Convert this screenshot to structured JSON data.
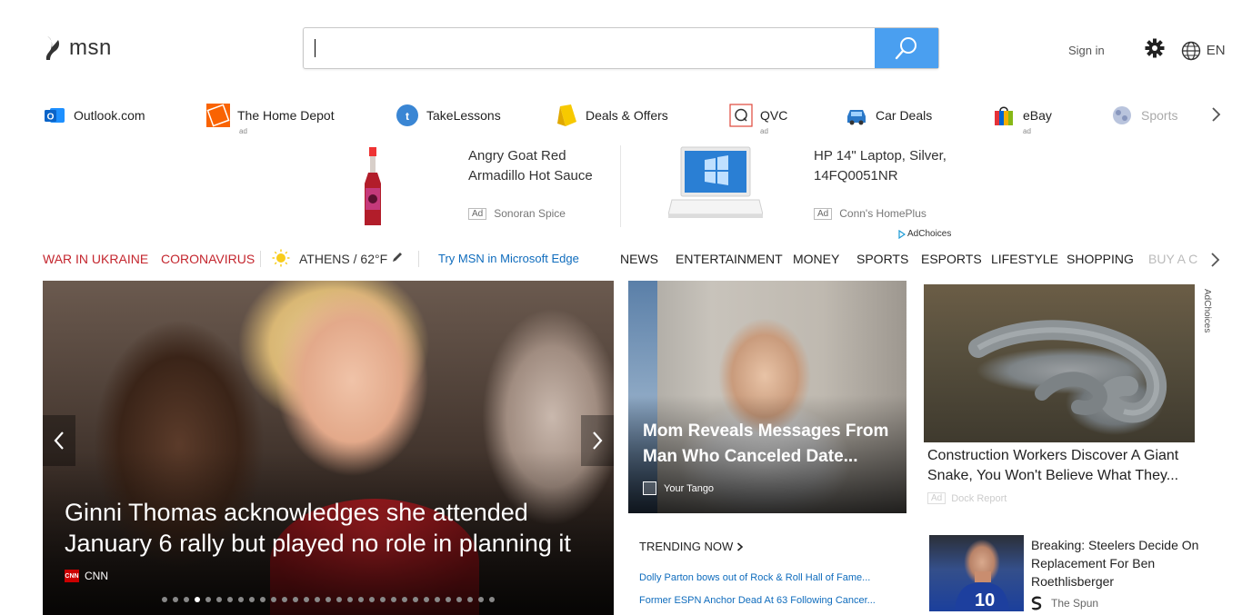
{
  "header": {
    "logo_text": "msn",
    "search_placeholder": "",
    "sign_in": "Sign in",
    "language": "EN"
  },
  "quicklinks": [
    {
      "label": "Outlook.com",
      "icon": "outlook-icon",
      "ad": ""
    },
    {
      "label": "The Home Depot",
      "icon": "home-depot-icon",
      "ad": "ad"
    },
    {
      "label": "TakeLessons",
      "icon": "takelessons-icon",
      "ad": ""
    },
    {
      "label": "Deals & Offers",
      "icon": "deals-icon",
      "ad": ""
    },
    {
      "label": "QVC",
      "icon": "qvc-icon",
      "ad": "ad"
    },
    {
      "label": "Car Deals",
      "icon": "car-icon",
      "ad": ""
    },
    {
      "label": "eBay",
      "icon": "ebay-icon",
      "ad": "ad"
    },
    {
      "label": "Sports",
      "icon": "sports-icon",
      "ad": ""
    }
  ],
  "ad_strip": {
    "items": [
      {
        "title": "Angry Goat Red Armadillo Hot Sauce",
        "badge": "Ad",
        "advertiser": "Sonoran Spice"
      },
      {
        "title": "HP 14\" Laptop, Silver, 14FQ0051NR",
        "badge": "Ad",
        "advertiser": "Conn's HomePlus"
      }
    ],
    "adchoices": "AdChoices"
  },
  "nav": {
    "war": "WAR IN UKRAINE",
    "corona": "CORONAVIRUS",
    "weather": "ATHENS / 62°F",
    "edge": "Try MSN in Microsoft Edge",
    "categories": [
      "NEWS",
      "ENTERTAINMENT",
      "MONEY",
      "SPORTS",
      "ESPORTS",
      "LIFESTYLE",
      "SHOPPING",
      "BUY A C"
    ]
  },
  "hero": {
    "title": "Ginni Thomas acknowledges she attended January 6 rally but played no role in planning it",
    "source": "CNN",
    "source_logo": "CNN",
    "dots_total": 31,
    "active_dot": 3
  },
  "mid_card": {
    "title": "Mom Reveals Messages From Man Who Canceled Date...",
    "source": "Your Tango"
  },
  "right_ad": {
    "title": "Construction Workers Discover A Giant Snake, You Won't Believe What They...",
    "badge": "Ad",
    "advertiser": "Dock Report",
    "adchoices": "AdChoices"
  },
  "trending": {
    "heading": "TRENDING NOW",
    "items": [
      "Dolly Parton bows out of Rock & Roll Hall of Fame...",
      "Former ESPN Anchor Dead At 63 Following Cancer..."
    ]
  },
  "steelers": {
    "title": "Breaking: Steelers Decide On Replacement For Ben Roethlisberger",
    "source": "The Spun"
  },
  "colors": {
    "accent_blue": "#4a9ff0",
    "link_blue": "#0f6cbd",
    "news_red": "#c4262e"
  }
}
